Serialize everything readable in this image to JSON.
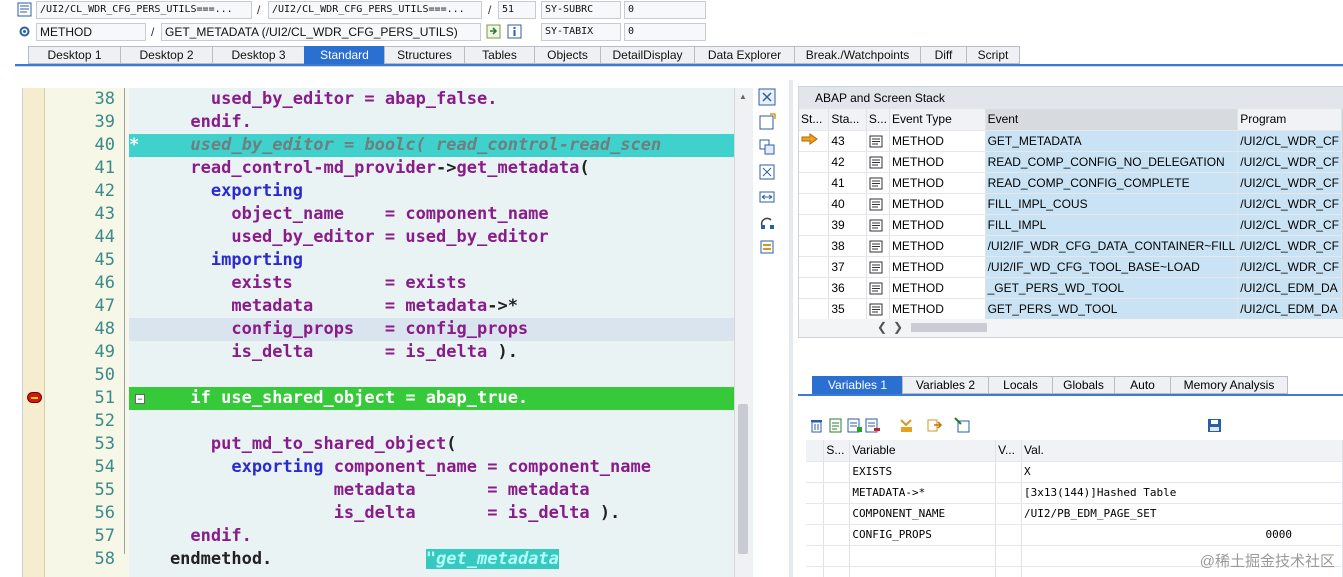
{
  "info": {
    "row1": {
      "program1": "/UI2/CL_WDR_CFG_PERS_UTILS===...",
      "sep": "/",
      "program2": "/UI2/CL_WDR_CFG_PERS_UTILS===...",
      "sep2": "/",
      "line": "51",
      "var_name": "SY-SUBRC",
      "var_value": "0"
    },
    "row2": {
      "type": "METHOD",
      "sep": "/",
      "method": "GET_METADATA (/UI2/CL_WDR_CFG_PERS_UTILS)",
      "var_name": "SY-TABIX",
      "var_value": "0"
    }
  },
  "tabs": [
    {
      "label": "Desktop 1"
    },
    {
      "label": "Desktop 2"
    },
    {
      "label": "Desktop 3"
    },
    {
      "label": "Standard",
      "active": true
    },
    {
      "label": "Structures"
    },
    {
      "label": "Tables"
    },
    {
      "label": "Objects"
    },
    {
      "label": "DetailDisplay"
    },
    {
      "label": "Data Explorer"
    },
    {
      "label": "Break./Watchpoints"
    },
    {
      "label": "Diff"
    },
    {
      "label": "Script"
    }
  ],
  "code": {
    "lines": [
      {
        "num": "38",
        "segments": [
          {
            "t": "        used_by_editor = abap_false.",
            "c": "id"
          }
        ]
      },
      {
        "num": "39",
        "segments": [
          {
            "t": "      endif.",
            "c": "kw"
          }
        ]
      },
      {
        "num": "40",
        "hl": "teal",
        "segments": [
          {
            "t": "*",
            "c": "wht"
          },
          {
            "t": "     used_by_editor = boolc( read_control-read_scen",
            "c": "cm"
          }
        ]
      },
      {
        "num": "41",
        "segments": [
          {
            "t": "      read_control-md_provider",
            "c": "id"
          },
          {
            "t": "->",
            "c": "plain"
          },
          {
            "t": "get_metadata",
            "c": "id"
          },
          {
            "t": "(",
            "c": "plain"
          }
        ]
      },
      {
        "num": "42",
        "segments": [
          {
            "t": "        exporting",
            "c": "kw2"
          }
        ]
      },
      {
        "num": "43",
        "segments": [
          {
            "t": "          object_name    = component_name",
            "c": "id"
          }
        ]
      },
      {
        "num": "44",
        "segments": [
          {
            "t": "          used_by_editor = used_by_editor",
            "c": "id"
          }
        ]
      },
      {
        "num": "45",
        "segments": [
          {
            "t": "        importing",
            "c": "kw2"
          }
        ]
      },
      {
        "num": "46",
        "segments": [
          {
            "t": "          exists         = exists",
            "c": "id"
          }
        ]
      },
      {
        "num": "47",
        "segments": [
          {
            "t": "          metadata       = metadata",
            "c": "id"
          },
          {
            "t": "->*",
            "c": "plain"
          }
        ]
      },
      {
        "num": "48",
        "hl": "cursor",
        "segments": [
          {
            "t": "          config_props   = config_props",
            "c": "id"
          }
        ]
      },
      {
        "num": "49",
        "segments": [
          {
            "t": "          is_delta       = is_delta ",
            "c": "id"
          },
          {
            "t": ").",
            "c": "plain"
          }
        ]
      },
      {
        "num": "50",
        "segments": [
          {
            "t": "",
            "c": "plain"
          }
        ]
      },
      {
        "num": "51",
        "hl": "green",
        "segments": [
          {
            "t": "      if use_shared_object = abap_true.",
            "c": "wht"
          }
        ]
      },
      {
        "num": "52",
        "segments": [
          {
            "t": "",
            "c": "plain"
          }
        ]
      },
      {
        "num": "53",
        "segments": [
          {
            "t": "        put_md_to_shared_object",
            "c": "id"
          },
          {
            "t": "(",
            "c": "plain"
          }
        ]
      },
      {
        "num": "54",
        "segments": [
          {
            "t": "          exporting ",
            "c": "kw2"
          },
          {
            "t": "component_name = component_name",
            "c": "id"
          }
        ]
      },
      {
        "num": "55",
        "segments": [
          {
            "t": "                    metadata       = metadata",
            "c": "id"
          }
        ]
      },
      {
        "num": "56",
        "segments": [
          {
            "t": "                    is_delta       = is_delta ",
            "c": "id"
          },
          {
            "t": ").",
            "c": "plain"
          }
        ]
      },
      {
        "num": "57",
        "segments": [
          {
            "t": "      endif.",
            "c": "kw"
          }
        ]
      },
      {
        "num": "58",
        "segments": [
          {
            "t": "    endmethod.",
            "c": "plain"
          },
          {
            "t": "               ",
            "c": "plain"
          },
          {
            "t": "\"get_metadata",
            "c": "cm-inline"
          }
        ]
      }
    ]
  },
  "stack": {
    "title": "ABAP and Screen Stack",
    "columns": [
      "St...",
      "Sta...",
      "S...",
      "Event Type",
      "Event",
      "Program"
    ],
    "rows": [
      {
        "current": true,
        "level": "43",
        "type": "METHOD",
        "event": "GET_METADATA",
        "program": "/UI2/CL_WDR_CF"
      },
      {
        "level": "42",
        "type": "METHOD",
        "event": "READ_COMP_CONFIG_NO_DELEGATION",
        "program": "/UI2/CL_WDR_CF"
      },
      {
        "level": "41",
        "type": "METHOD",
        "event": "READ_COMP_CONFIG_COMPLETE",
        "program": "/UI2/CL_WDR_CF"
      },
      {
        "level": "40",
        "type": "METHOD",
        "event": "FILL_IMPL_COUS",
        "program": "/UI2/CL_WDR_CF"
      },
      {
        "level": "39",
        "type": "METHOD",
        "event": "FILL_IMPL",
        "program": "/UI2/CL_WDR_CF"
      },
      {
        "level": "38",
        "type": "METHOD",
        "event": "/UI2/IF_WDR_CFG_DATA_CONTAINER~FILL",
        "program": "/UI2/CL_WDR_CF"
      },
      {
        "level": "37",
        "type": "METHOD",
        "event": "/UI2/IF_WD_CFG_TOOL_BASE~LOAD",
        "program": "/UI2/CL_WDR_CF"
      },
      {
        "level": "36",
        "type": "METHOD",
        "event": "_GET_PERS_WD_TOOL",
        "program": "/UI2/CL_EDM_DA"
      },
      {
        "level": "35",
        "type": "METHOD",
        "event": "GET_PERS_WD_TOOL",
        "program": "/UI2/CL_EDM_DA"
      }
    ]
  },
  "vars_tabs": [
    {
      "label": "Variables 1",
      "active": true
    },
    {
      "label": "Variables 2"
    },
    {
      "label": "Locals"
    },
    {
      "label": "Globals"
    },
    {
      "label": "Auto"
    },
    {
      "label": "Memory Analysis"
    }
  ],
  "vars": {
    "columns": [
      "S...",
      "Variable",
      "V...",
      "Val."
    ],
    "rows": [
      {
        "name": "EXISTS",
        "value": "X",
        "align": "left"
      },
      {
        "name": "METADATA->*",
        "value": "[3x13(144)]Hashed Table",
        "align": "left"
      },
      {
        "name": "COMPONENT_NAME",
        "value": "/UI2/PB_EDM_PAGE_SET",
        "align": "left"
      },
      {
        "name": "CONFIG_PROPS",
        "value": "0000",
        "align": "right"
      },
      {
        "name": "",
        "value": "",
        "align": "left"
      },
      {
        "name": "",
        "value": "",
        "align": "left"
      }
    ]
  },
  "watermark": "@稀土掘金技术社区",
  "colors": {
    "accent": "#2b6fd0",
    "line_highlight": "#36c93a",
    "comment_highlight": "#3fd1cc",
    "stack_cell": "#c9e3f5"
  }
}
